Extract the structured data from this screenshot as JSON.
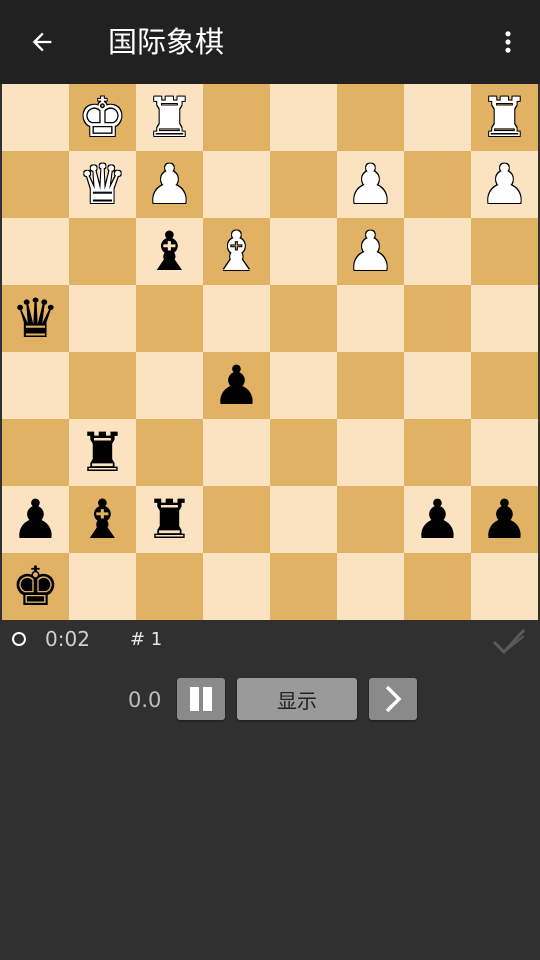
{
  "appbar": {
    "title": "国际象棋"
  },
  "board": {
    "rows": [
      [
        "",
        "K",
        "R",
        "",
        "",
        "",
        "",
        "R"
      ],
      [
        "",
        "Q",
        "P",
        "",
        "",
        "P",
        "",
        "P"
      ],
      [
        "",
        "",
        "b",
        "B",
        "",
        "P",
        "",
        ""
      ],
      [
        "q",
        "",
        "",
        "",
        "",
        "",
        "",
        ""
      ],
      [
        "",
        "",
        "",
        "p",
        "",
        "",
        "",
        ""
      ],
      [
        "",
        "r",
        "",
        "",
        "",
        "",
        "",
        ""
      ],
      [
        "p",
        "b",
        "r",
        "",
        "",
        "",
        "p",
        "p"
      ],
      [
        "k",
        "",
        "",
        "",
        "",
        "",
        "",
        ""
      ]
    ],
    "light_color": "#fbe3c2",
    "dark_color": "#e1b164"
  },
  "status": {
    "timer": "0:02",
    "move_number": "# 1"
  },
  "controls": {
    "score": "0.0",
    "show_label": "显示"
  }
}
